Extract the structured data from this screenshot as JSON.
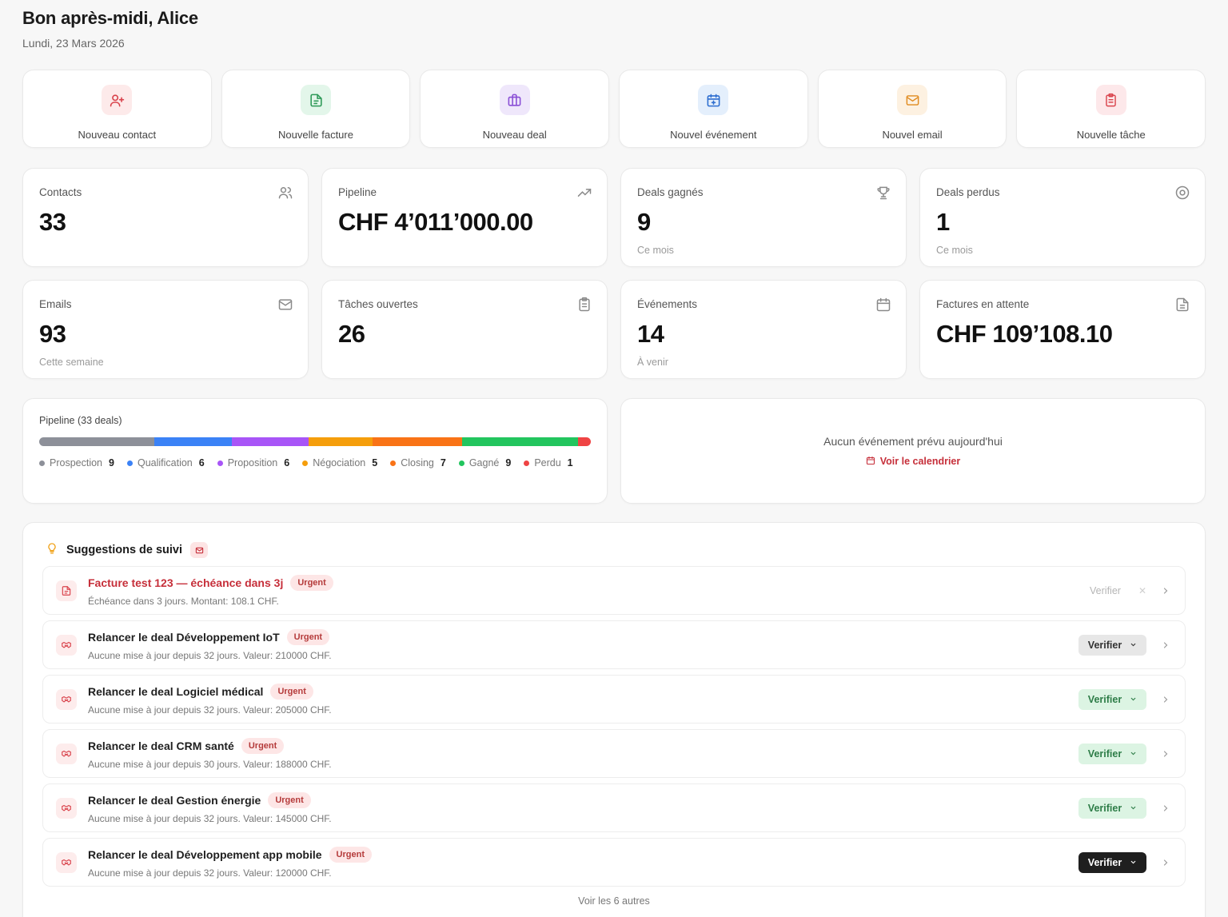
{
  "header": {
    "greeting": "Bon après-midi, Alice",
    "date": "Lundi, 23 Mars 2026"
  },
  "quick_actions": [
    {
      "label": "Nouveau contact",
      "icon": "user-plus-icon",
      "bg": "#fdeaea",
      "fg": "#d9434c"
    },
    {
      "label": "Nouvelle facture",
      "icon": "invoice-icon",
      "bg": "#e3f6ea",
      "fg": "#2f9a58"
    },
    {
      "label": "Nouveau deal",
      "icon": "briefcase-icon",
      "bg": "#efe7fb",
      "fg": "#8a4fd6"
    },
    {
      "label": "Nouvel événement",
      "icon": "calendar-plus-icon",
      "bg": "#e4effc",
      "fg": "#2f6fd0"
    },
    {
      "label": "Nouvel email",
      "icon": "mail-icon",
      "bg": "#fdf1e1",
      "fg": "#e08a1e"
    },
    {
      "label": "Nouvelle tâche",
      "icon": "clipboard-icon",
      "bg": "#fde8ea",
      "fg": "#d9434c"
    }
  ],
  "stats": [
    {
      "label": "Contacts",
      "value": "33",
      "sub": "",
      "icon": "users-icon"
    },
    {
      "label": "Pipeline",
      "value": "CHF 4’011’000.00",
      "sub": "",
      "icon": "trend-up-icon"
    },
    {
      "label": "Deals gagnés",
      "value": "9",
      "sub": "Ce mois",
      "icon": "trophy-icon"
    },
    {
      "label": "Deals perdus",
      "value": "1",
      "sub": "Ce mois",
      "icon": "target-icon"
    },
    {
      "label": "Emails",
      "value": "93",
      "sub": "Cette semaine",
      "icon": "mail-icon"
    },
    {
      "label": "Tâches ouvertes",
      "value": "26",
      "sub": "",
      "icon": "clipboard-icon"
    },
    {
      "label": "Événements",
      "value": "14",
      "sub": "À venir",
      "icon": "calendar-icon"
    },
    {
      "label": "Factures en attente",
      "value": "CHF 109’108.10",
      "sub": "",
      "icon": "file-icon"
    }
  ],
  "pipeline": {
    "title": "Pipeline (33 deals)",
    "stages": [
      {
        "name": "Prospection",
        "count": 9,
        "color": "#8d9099"
      },
      {
        "name": "Qualification",
        "count": 6,
        "color": "#3b82f6"
      },
      {
        "name": "Proposition",
        "count": 6,
        "color": "#a855f7"
      },
      {
        "name": "Négociation",
        "count": 5,
        "color": "#f59e0b"
      },
      {
        "name": "Closing",
        "count": 7,
        "color": "#f97316"
      },
      {
        "name": "Gagné",
        "count": 9,
        "color": "#22c55e"
      },
      {
        "name": "Perdu",
        "count": 1,
        "color": "#ef4444"
      }
    ]
  },
  "events": {
    "empty": "Aucun événement prévu aujourd'hui",
    "link": "Voir le calendrier"
  },
  "suggestions": {
    "title": "Suggestions de suivi",
    "items": [
      {
        "title": "Facture test 123 — échéance dans 3j",
        "badge": "Urgent",
        "desc": "Échéance dans 3 jours. Montant: 108.1 CHF.",
        "action": "Verifier",
        "style": "plain",
        "icon": "invoice-icon",
        "highlight": true
      },
      {
        "title": "Relancer le deal Développement IoT",
        "badge": "Urgent",
        "desc": "Aucune mise à jour depuis 32 jours. Valeur: 210000 CHF.",
        "action": "Verifier",
        "style": "gray",
        "icon": "handshake-icon",
        "highlight": false
      },
      {
        "title": "Relancer le deal Logiciel médical",
        "badge": "Urgent",
        "desc": "Aucune mise à jour depuis 32 jours. Valeur: 205000 CHF.",
        "action": "Verifier",
        "style": "green",
        "icon": "handshake-icon",
        "highlight": false
      },
      {
        "title": "Relancer le deal CRM santé",
        "badge": "Urgent",
        "desc": "Aucune mise à jour depuis 30 jours. Valeur: 188000 CHF.",
        "action": "Verifier",
        "style": "green",
        "icon": "handshake-icon",
        "highlight": false
      },
      {
        "title": "Relancer le deal Gestion énergie",
        "badge": "Urgent",
        "desc": "Aucune mise à jour depuis 32 jours. Valeur: 145000 CHF.",
        "action": "Verifier",
        "style": "green",
        "icon": "handshake-icon",
        "highlight": false
      },
      {
        "title": "Relancer le deal Développement app mobile",
        "badge": "Urgent",
        "desc": "Aucune mise à jour depuis 32 jours. Valeur: 120000 CHF.",
        "action": "Verifier",
        "style": "dark",
        "icon": "handshake-icon",
        "highlight": false
      }
    ],
    "more": "Voir les 6 autres"
  }
}
